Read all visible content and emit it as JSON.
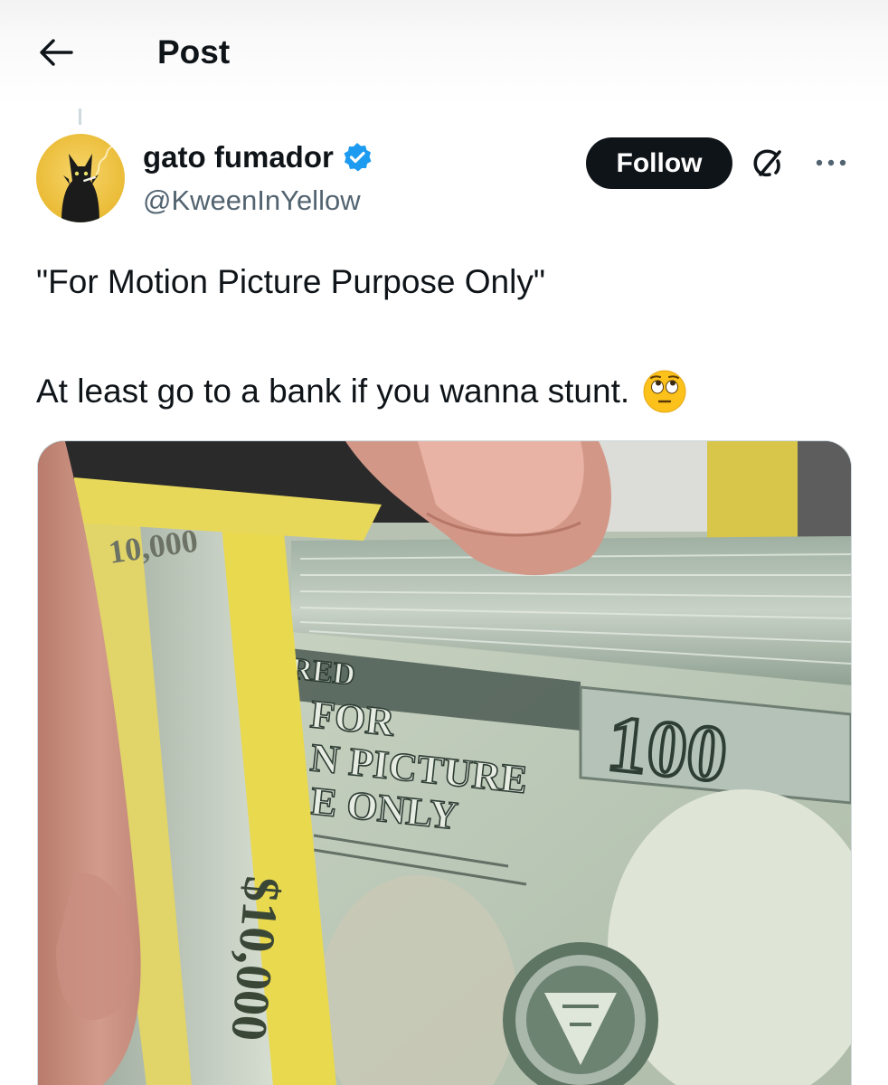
{
  "header": {
    "title": "Post",
    "back_icon": "arrow-left-icon"
  },
  "author": {
    "display_name": "gato fumador",
    "handle": "@KweenInYellow",
    "verified": true,
    "badge_color": "#1d9bf0",
    "avatar_background": "#f2c43d"
  },
  "actions": {
    "follow_label": "Follow",
    "grok_icon": "grok-icon",
    "more_icon": "more-horizontal-icon"
  },
  "post": {
    "line1": "\"For Motion Picture Purpose Only\"",
    "line2": "At least go to a bank if you wanna stunt.",
    "emoji_name": "face-with-rolling-eyes"
  },
  "media": {
    "description_icon": "photo-stack-of-prop-bills",
    "strap_text_1": "$10,000",
    "strap_text_2": "10,000",
    "bill_text_1": "RED",
    "bill_text_2": "FOR",
    "bill_text_3": "N PICTURE",
    "bill_text_4": "E ONLY",
    "bill_denomination": "100"
  },
  "colors": {
    "text_primary": "#0f1419",
    "text_secondary": "#536471",
    "follow_bg": "#0f1419",
    "follow_text": "#ffffff",
    "border": "#cfd9de"
  }
}
